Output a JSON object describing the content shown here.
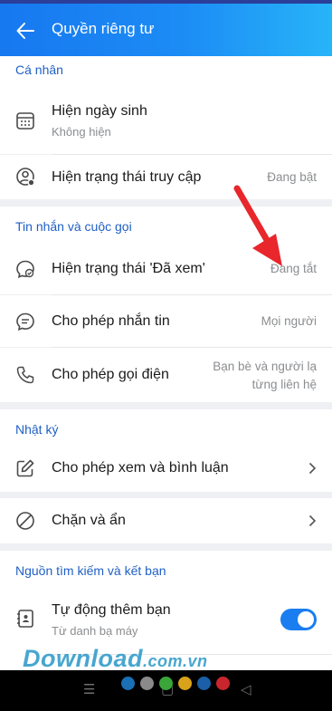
{
  "header": {
    "title": "Quyền riêng tư"
  },
  "sections": {
    "personal": "Cá nhân",
    "messages": "Tin nhắn và cuộc gọi",
    "diary": "Nhật ký",
    "search": "Nguồn tìm kiếm và kết bạn"
  },
  "rows": {
    "birthday": {
      "title": "Hiện ngày sinh",
      "sub": "Không hiện"
    },
    "access_status": {
      "title": "Hiện trạng thái truy cập",
      "value": "Đang bật"
    },
    "seen_status": {
      "title": "Hiện trạng thái 'Đã xem'",
      "value": "Đang tắt"
    },
    "allow_messages": {
      "title": "Cho phép nhắn tin",
      "value": "Mọi người"
    },
    "allow_calls": {
      "title": "Cho phép gọi điện",
      "value_line1": "Bạn bè và người lạ",
      "value_line2": "từng liên hệ"
    },
    "allow_comments": {
      "title": "Cho phép xem và bình luận"
    },
    "block_hide": {
      "title": "Chặn và ẩn"
    },
    "auto_add": {
      "title": "Tự động thêm bạn",
      "sub": "Từ danh bạ máy",
      "toggle_on": true
    }
  },
  "watermark": {
    "brand": "Download",
    "domain": ".com.vn"
  },
  "colors": {
    "accent": "#1a7ef0",
    "section_title": "#1f5fc4",
    "arrow": "#e8262b"
  }
}
